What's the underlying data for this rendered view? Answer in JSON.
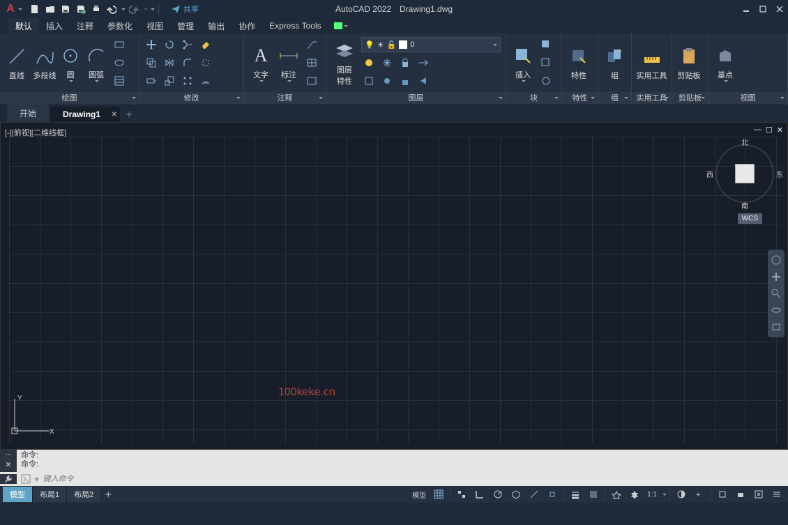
{
  "title": {
    "app": "AutoCAD 2022",
    "file": "Drawing1.dwg"
  },
  "share": "共享",
  "menu": {
    "tabs": [
      "默认",
      "插入",
      "注释",
      "参数化",
      "视图",
      "管理",
      "输出",
      "协作",
      "Express Tools"
    ]
  },
  "ribbon": {
    "draw": {
      "title": "绘图",
      "line": "直线",
      "polyline": "多段线",
      "circle": "圆",
      "arc": "圆弧"
    },
    "modify": {
      "title": "修改"
    },
    "annotate": {
      "title": "注释",
      "text": "文字",
      "dim": "标注"
    },
    "layers": {
      "title": "图层",
      "props": "图层\n特性",
      "current": "0"
    },
    "blocks": {
      "title": "块",
      "insert": "插入"
    },
    "props": {
      "title": "特性",
      "btn": "特性"
    },
    "groups": {
      "title": "组",
      "btn": "组"
    },
    "util": {
      "title": "实用工具",
      "btn": "实用工具"
    },
    "clip": {
      "title": "剪贴板",
      "btn": "剪贴板"
    },
    "view": {
      "title": "视图",
      "base": "基点"
    }
  },
  "file_tabs": {
    "start": "开始",
    "active": "Drawing1"
  },
  "viewport": {
    "label": "[-][俯视][二维线框]",
    "wcs": "WCS",
    "compass": {
      "n": "北",
      "s": "南",
      "e": "东",
      "w": "西"
    }
  },
  "watermark": "100keke.cn",
  "ucs": {
    "x": "X",
    "y": "Y"
  },
  "command": {
    "hist1": "命令:",
    "hist2": "命令:",
    "placeholder": "键入命令"
  },
  "layout_tabs": {
    "model": "模型",
    "l1": "布局1",
    "l2": "布局2"
  },
  "status": {
    "model": "模型",
    "scale": "1:1"
  }
}
